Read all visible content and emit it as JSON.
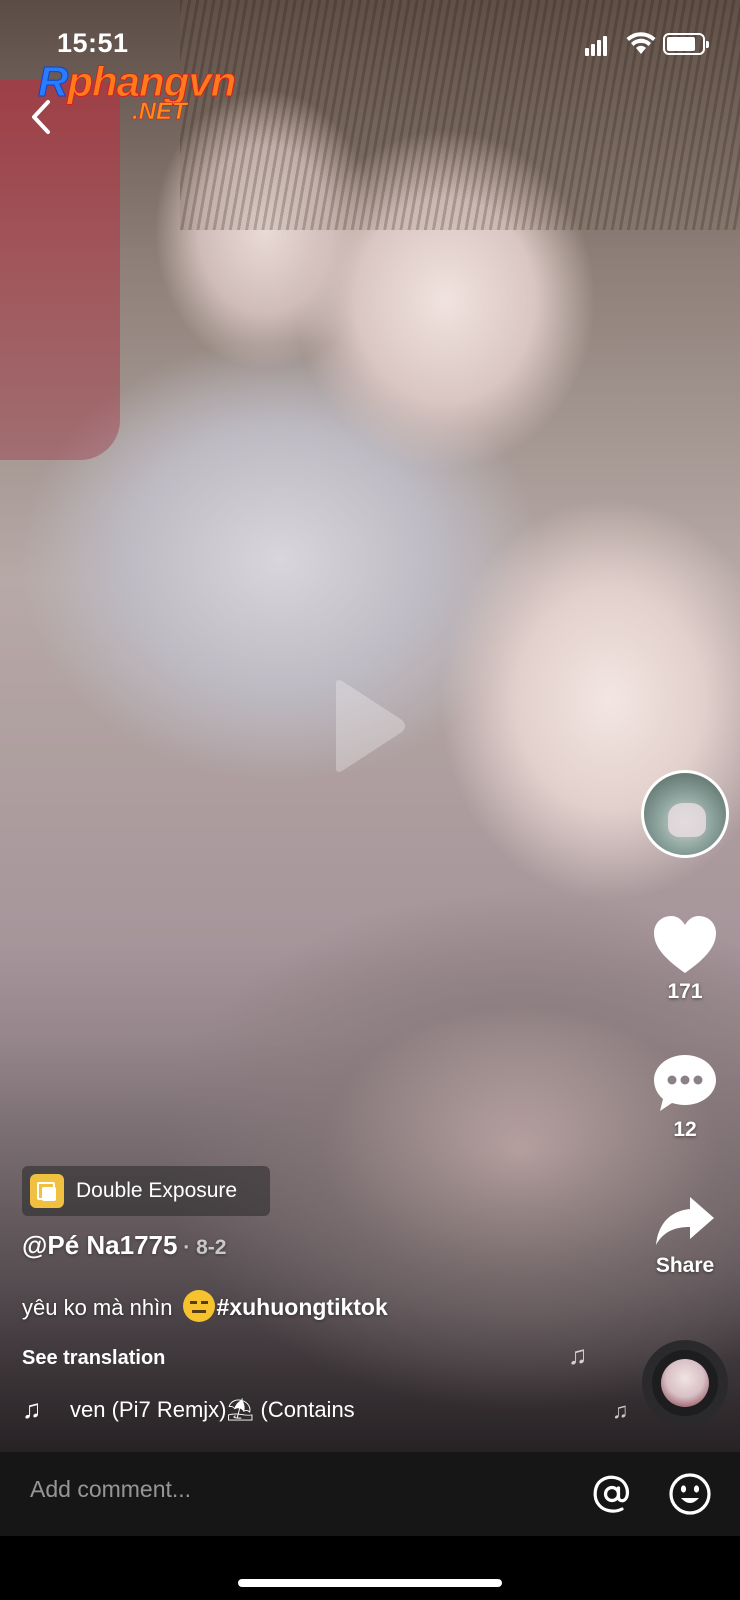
{
  "status_bar": {
    "time": "15:51"
  },
  "watermark": {
    "main_r": "R",
    "main_rest": "phangvn",
    "sub": ".NET"
  },
  "actions": {
    "like_count": "171",
    "comment_count": "12",
    "share_label": "Share"
  },
  "effect": {
    "label": "Double Exposure",
    "icon": "double-exposure-icon"
  },
  "post": {
    "username": "@Pé Na1775",
    "date": " · 8-2",
    "caption_text": "yêu ko mà nhìn ",
    "caption_hashtag": "#xuhuongtiktok",
    "see_translation": "See translation",
    "music_title": "ven (Pi7 Remjx)⛱ (Contains"
  },
  "comment_bar": {
    "placeholder": "Add comment..."
  },
  "colors": {
    "comment_bar_bg": "#161616",
    "badge_yellow": "#f0c040"
  }
}
